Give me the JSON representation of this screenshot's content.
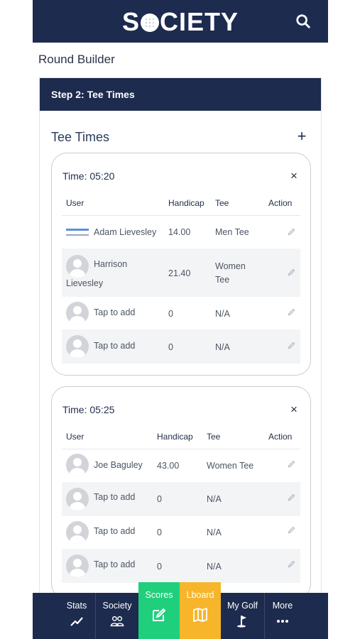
{
  "header": {
    "logo_text_left": "S",
    "logo_text_right": "CIETY"
  },
  "page_title": "Round Builder",
  "step": {
    "title": "Step 2: Tee Times"
  },
  "section": {
    "title": "Tee Times",
    "add_symbol": "+"
  },
  "columns_1": {
    "user": "User",
    "handicap": "Handicap",
    "tee": "Tee",
    "action": "Action"
  },
  "columns_2": {
    "user": "User",
    "handicap": "Handicap",
    "tee": "Tee",
    "action": "Action"
  },
  "tee_times": [
    {
      "time": "Time: 05:20",
      "close": "×",
      "rows": [
        {
          "name_line1": "Adam Lievesley",
          "name_line2": "",
          "handicap": "14.00",
          "tee_line1": "Men Tee",
          "tee_line2": ""
        },
        {
          "name_line1": "Harrison",
          "name_line2": "Lievesley",
          "handicap": "21.40",
          "tee_line1": "Women",
          "tee_line2": "Tee"
        },
        {
          "name_line1": "Tap to add",
          "name_line2": "",
          "handicap": "0",
          "tee_line1": "N/A",
          "tee_line2": ""
        },
        {
          "name_line1": "Tap to add",
          "name_line2": "",
          "handicap": "0",
          "tee_line1": "N/A",
          "tee_line2": ""
        }
      ]
    },
    {
      "time": "Time: 05:25",
      "close": "×",
      "rows": [
        {
          "name_line1": "Joe Baguley",
          "handicap": "43.00",
          "tee_line1": "Women Tee"
        },
        {
          "name_line1": "Tap to add",
          "handicap": "0",
          "tee_line1": "N/A"
        },
        {
          "name_line1": "Tap to add",
          "handicap": "0",
          "tee_line1": "N/A"
        },
        {
          "name_line1": "Tap to add",
          "handicap": "0",
          "tee_line1": "N/A"
        }
      ]
    }
  ],
  "nav": [
    {
      "label": "Stats",
      "icon": "trend-line-icon"
    },
    {
      "label": "Society",
      "icon": "group-icon"
    },
    {
      "label": "Scores",
      "icon": "edit-icon",
      "color": "#1fcf7c"
    },
    {
      "label": "Lboard",
      "icon": "map-icon",
      "color": "#f6b52a"
    },
    {
      "label": "My Golf",
      "icon": "golf-flag-icon"
    },
    {
      "label": "More",
      "icon": "dots-icon"
    }
  ],
  "colors": {
    "navy": "#1d2b4e",
    "green": "#1fcf7c",
    "amber": "#f6b52a"
  }
}
